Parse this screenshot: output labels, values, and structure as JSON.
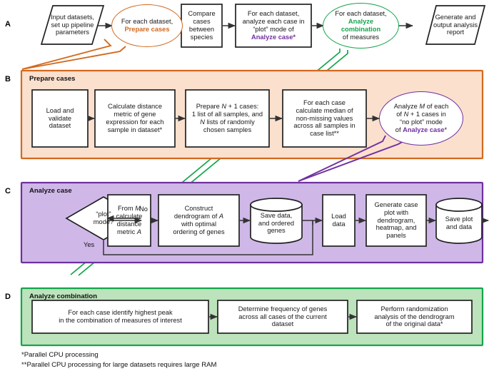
{
  "figure": {
    "footnotes": [
      "*Parallel CPU processing",
      "**Parallel CPU processing for large datasets requires large RAM"
    ]
  },
  "colors": {
    "orange_stroke": "#D2691E",
    "orange_fill": "#FBE0CE",
    "purple_stroke": "#7030A0",
    "purple_fill": "#CFB8E8",
    "green_stroke": "#14A54B",
    "green_fill": "#BCE3BC",
    "node_stroke": "#222222",
    "node_fill": "#FFFFFF"
  },
  "panels": [
    {
      "letter": "A",
      "title": "",
      "nodes": [
        {
          "id": "a1",
          "shape": "parallelogram",
          "text": "Input datasets,\nset up pipeline\nparameters"
        },
        {
          "id": "a2",
          "shape": "ellipse-orange",
          "text": "For each dataset,\nPrepare cases",
          "highlight": "Prepare cases"
        },
        {
          "id": "a3",
          "shape": "rect",
          "text": "Compare\ncases\nbetween\nspecies"
        },
        {
          "id": "a4",
          "shape": "rect",
          "text": "For each dataset,\nanalyze each case in\n“plot” mode of\nAnalyze case*",
          "highlight": "Analyze case*"
        },
        {
          "id": "a5",
          "shape": "ellipse-green",
          "text": "For each dataset,\nAnalyze combination\nof measures",
          "highlight": "Analyze combination"
        },
        {
          "id": "a6",
          "shape": "parallelogram",
          "text": "Generate and\noutput analysis\nreport"
        }
      ]
    },
    {
      "letter": "B",
      "title": "Prepare cases",
      "nodes": [
        {
          "id": "b1",
          "shape": "rect",
          "text": "Load and\nvalidate\ndataset"
        },
        {
          "id": "b2",
          "shape": "rect",
          "text": "Calculate distance\nmetric of gene\nexpression for each\nsample in dataset*"
        },
        {
          "id": "b3",
          "shape": "rect",
          "text": "Prepare N + 1 cases:\n1 list of all samples, and\nN lists of randomly\nchosen samples"
        },
        {
          "id": "b4",
          "shape": "rect",
          "text": "For each case\ncalculate median of\nnon-missing values\nacross all samples in\ncase list**"
        },
        {
          "id": "b5",
          "shape": "ellipse-purple",
          "text": "Analyze M of each\nof N + 1 cases in\n“no plot” mode\nof Analyze case*",
          "highlight": "Analyze case"
        }
      ]
    },
    {
      "letter": "C",
      "title": "Analyze case",
      "nodes": [
        {
          "id": "c1",
          "shape": "diamond",
          "text": "“plot”\nmode?"
        },
        {
          "id": "c2",
          "shape": "rect",
          "text": "From M\ncalculate\ndistance\nmetric A"
        },
        {
          "id": "c3",
          "shape": "rect",
          "text": "Construct\ndendrogram of A\nwith optimal\nordering of genes"
        },
        {
          "id": "c4",
          "shape": "cylinder",
          "text": "Save data,\nand ordered\ngenes"
        },
        {
          "id": "c5",
          "shape": "rect",
          "text": "Load\ndata"
        },
        {
          "id": "c6",
          "shape": "rect",
          "text": "Generate case\nplot with\ndendrogram,\nheatmap, and\npanels"
        },
        {
          "id": "c7",
          "shape": "cylinder",
          "text": "Save plot\nand data"
        }
      ],
      "edge_labels": [
        {
          "id": "c-no",
          "text": "No"
        },
        {
          "id": "c-yes",
          "text": "Yes"
        }
      ]
    },
    {
      "letter": "D",
      "title": "Analyze combination",
      "nodes": [
        {
          "id": "d1",
          "shape": "rect",
          "text": "For each case identify highest peak\nin the combination of measures of interest"
        },
        {
          "id": "d2",
          "shape": "rect",
          "text": "Determine frequency of genes\nacross all cases of the current\ndataset"
        },
        {
          "id": "d3",
          "shape": "rect",
          "text": "Perform randomization\nanalysis of the dendrogram\nof the original data*"
        }
      ]
    }
  ]
}
